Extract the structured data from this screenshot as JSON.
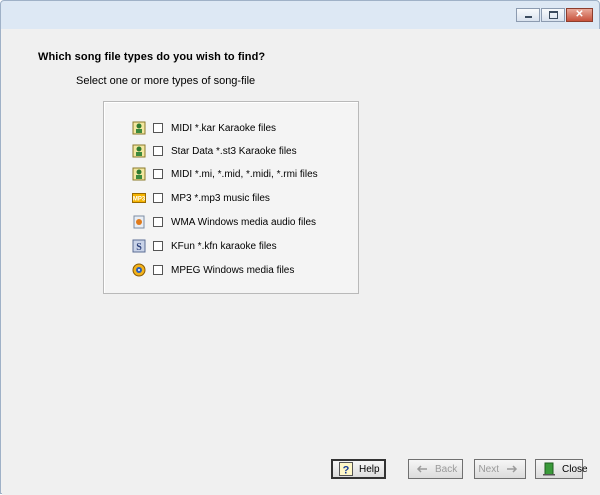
{
  "window": {
    "minimize_label": "",
    "maximize_label": "",
    "close_label": "✕"
  },
  "wizard": {
    "question": "Which song file types do you wish to find?",
    "subtitle": "Select one or more types of song-file"
  },
  "file_types": [
    {
      "label": "MIDI *.kar Karaoke files",
      "icon": "karaoke-singer-icon",
      "checked": false
    },
    {
      "label": "Star Data *.st3 Karaoke files",
      "icon": "karaoke-singer-icon",
      "checked": false
    },
    {
      "label": "MIDI *.mi, *.mid, *.midi, *.rmi files",
      "icon": "karaoke-singer-icon",
      "checked": false
    },
    {
      "label": "MP3 *.mp3 music files",
      "icon": "mp3-icon",
      "checked": false
    },
    {
      "label": "WMA Windows media audio files",
      "icon": "wma-icon",
      "checked": false
    },
    {
      "label": "KFun *.kfn karaoke files",
      "icon": "kfun-icon",
      "checked": false
    },
    {
      "label": "MPEG  Windows media  files",
      "icon": "mpeg-icon",
      "checked": false
    }
  ],
  "buttons": {
    "help": "Help",
    "back": "Back",
    "next": "Next",
    "close": "Close"
  },
  "colors": {
    "accent_close": "#c7513b",
    "panel": "#f0f0f0"
  }
}
